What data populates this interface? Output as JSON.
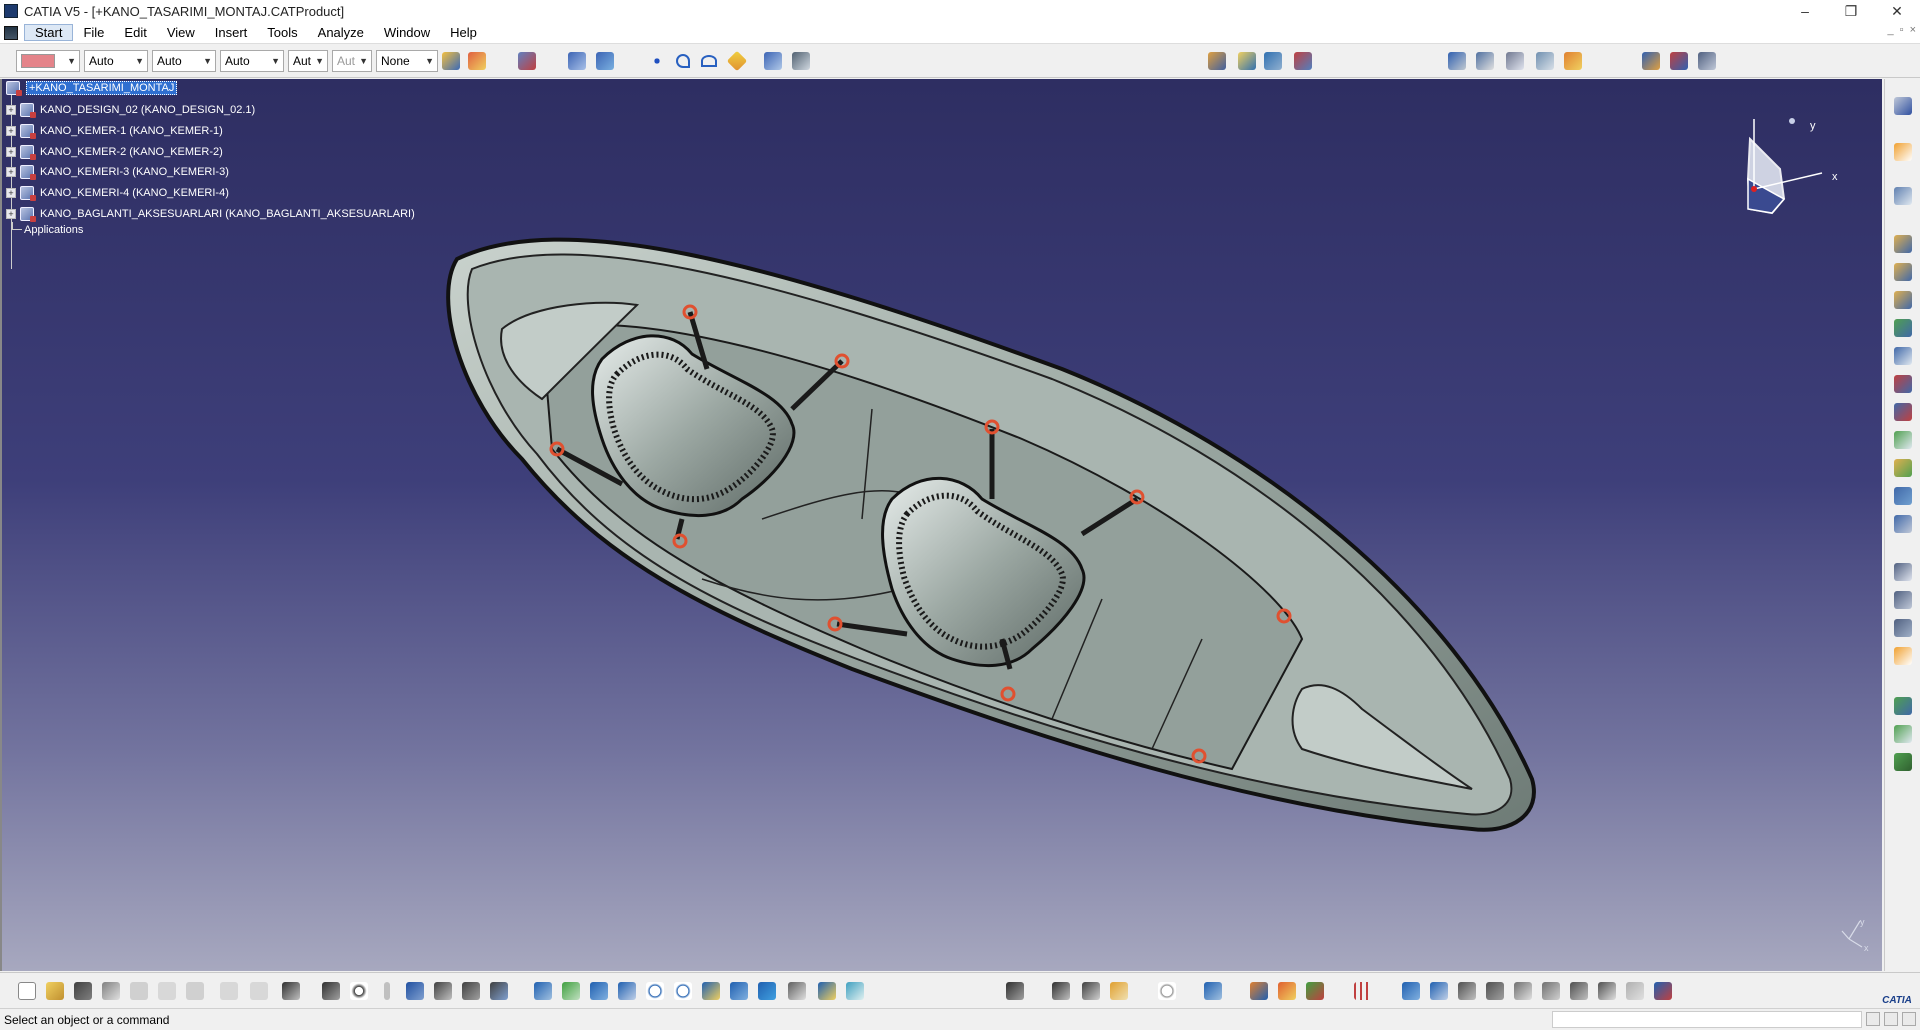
{
  "window": {
    "title": "CATIA V5 - [+KANO_TASARIMI_MONTAJ.CATProduct]",
    "minimize": "–",
    "restore": "❐",
    "close": "✕"
  },
  "menu": {
    "items": [
      "Start",
      "File",
      "Edit",
      "View",
      "Insert",
      "Tools",
      "Analyze",
      "Window",
      "Help"
    ]
  },
  "toolbar_top": {
    "combos": [
      "Auto",
      "Auto",
      "Auto",
      "Aut",
      "Aut",
      "None"
    ],
    "color_swatch": "#e4848a"
  },
  "tree": {
    "root": "+KANO_TASARIMI_MONTAJ",
    "children": [
      "KANO_DESIGN_02 (KANO_DESIGN_02.1)",
      "KANO_KEMER-1 (KANO_KEMER-1)",
      "KANO_KEMER-2 (KANO_KEMER-2)",
      "KANO_KEMERI-3 (KANO_KEMERI-3)",
      "KANO_KEMERI-4 (KANO_KEMERI-4)",
      "KANO_BAGLANTI_AKSESUARLARI (KANO_BAGLANTI_AKSESUARLARI)"
    ],
    "applications": "Applications"
  },
  "compass": {
    "y_label": "y",
    "x_label": "x"
  },
  "axis_triad": {
    "y_label": "y",
    "x_label": "x"
  },
  "status": {
    "message": "Select an object or a command"
  },
  "brand": {
    "logo_text": "CATIA"
  },
  "colors": {
    "viewport_top": "#2e2e62",
    "viewport_bottom": "#a7a8bf",
    "hull": "#8e9c96",
    "hull_light": "#c9d2cd",
    "ring_accent": "#e05030",
    "selection": "#2f6fd0"
  }
}
